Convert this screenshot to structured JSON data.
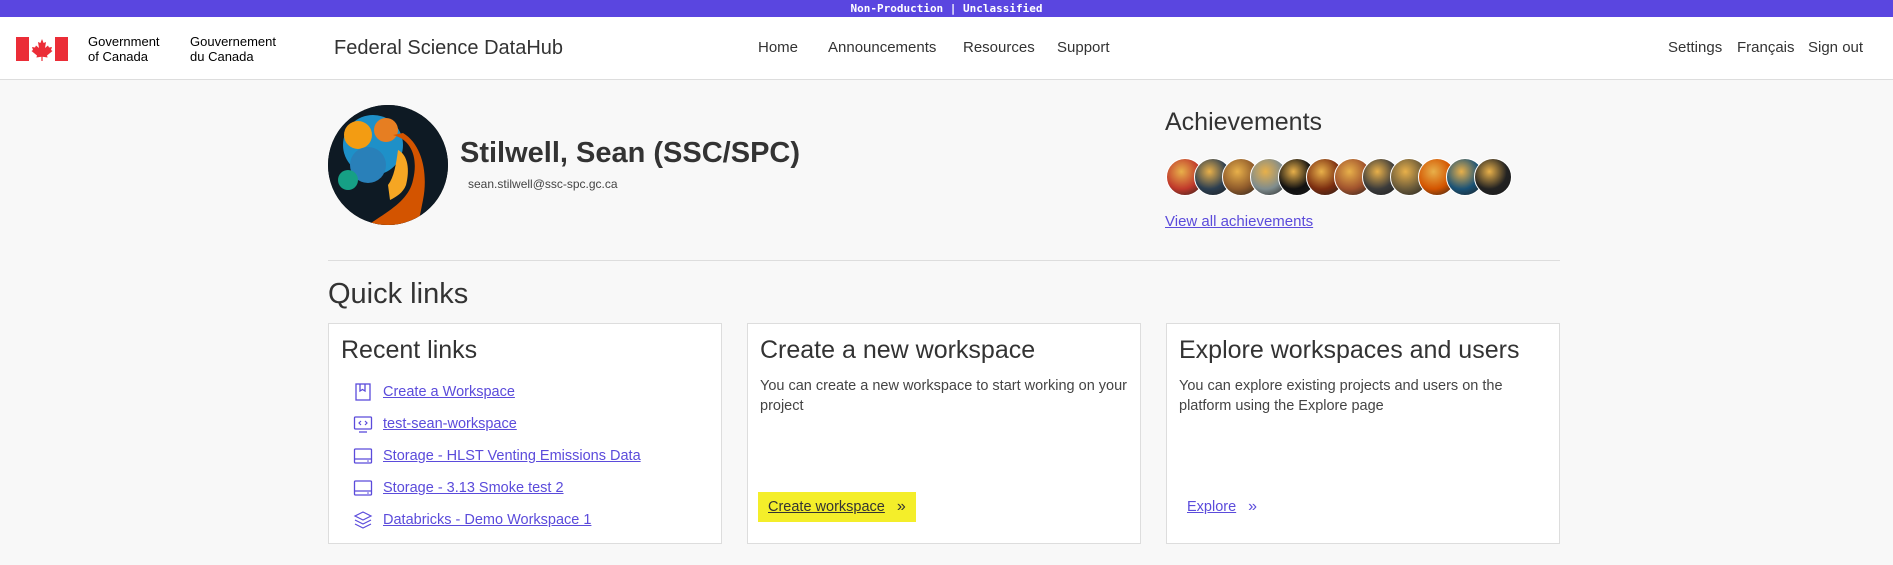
{
  "banner": "Non-Production | Unclassified",
  "header": {
    "gov_en_line1": "Government",
    "gov_en_line2": "of Canada",
    "gov_fr_line1": "Gouvernement",
    "gov_fr_line2": "du Canada",
    "site_title": "Federal Science DataHub",
    "nav": [
      "Home",
      "Announcements",
      "Resources",
      "Support"
    ],
    "right_nav": [
      "Settings",
      "Français",
      "Sign out"
    ]
  },
  "profile": {
    "name": "Stilwell, Sean (SSC/SPC)",
    "email": "sean.stilwell@ssc-spc.gc.ca"
  },
  "achievements": {
    "title": "Achievements",
    "badge_colors": [
      "#c0392b",
      "#2c3e50",
      "#8e5a2b",
      "#7f8c8d",
      "#111111",
      "#7b2d10",
      "#a0522d",
      "#3b3b3b",
      "#6b5b3a",
      "#d35400",
      "#1a5276",
      "#222222"
    ],
    "view_all": "View all achievements"
  },
  "quick_links": {
    "title": "Quick links",
    "recent": {
      "title": "Recent links",
      "items": [
        {
          "label": "Create a Workspace",
          "icon": "bookmark-icon"
        },
        {
          "label": "test-sean-workspace",
          "icon": "code-monitor-icon"
        },
        {
          "label": "Storage - HLST Venting Emissions Data",
          "icon": "storage-icon"
        },
        {
          "label": "Storage - 3.13 Smoke test 2",
          "icon": "storage-icon"
        },
        {
          "label": "Databricks - Demo Workspace 1",
          "icon": "layers-icon"
        }
      ]
    },
    "create": {
      "title": "Create a new workspace",
      "description": "You can create a new workspace to start working on your project",
      "action": "Create workspace"
    },
    "explore": {
      "title": "Explore workspaces and users",
      "description": "You can explore existing projects and users on the platform using the Explore page",
      "action": "Explore"
    }
  },
  "colors": {
    "banner": "#5a46e0",
    "link": "#5b4bdb",
    "highlight": "#f4ee2a",
    "flag_red": "#eb2d37"
  }
}
